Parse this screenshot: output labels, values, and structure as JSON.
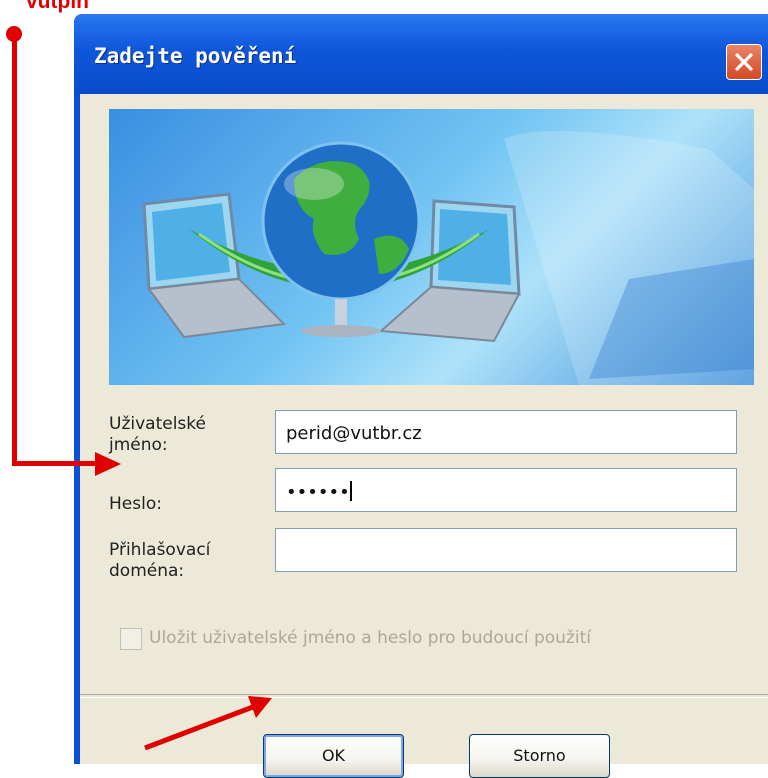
{
  "annotation": {
    "label": "vutpin"
  },
  "dialog": {
    "title": "Zadejte pověření",
    "fields": [
      {
        "label": "Uživatelské\njméno:",
        "value": "perid@vutbr.cz"
      },
      {
        "label": "Heslo:",
        "value": "••••••"
      },
      {
        "label": "Přihlašovací\ndoména:",
        "value": ""
      }
    ],
    "remember_label": "Uložit uživatelské jméno a heslo pro budoucí použití",
    "remember_checked": false,
    "ok_label": "OK",
    "cancel_label": "Storno"
  },
  "icons": {
    "close": "close-icon",
    "banner": "network-globe-illustration"
  },
  "colors": {
    "annotation": "#e00000",
    "titlebar": "#0a4ccb",
    "window_bg": "#ece9d8"
  }
}
